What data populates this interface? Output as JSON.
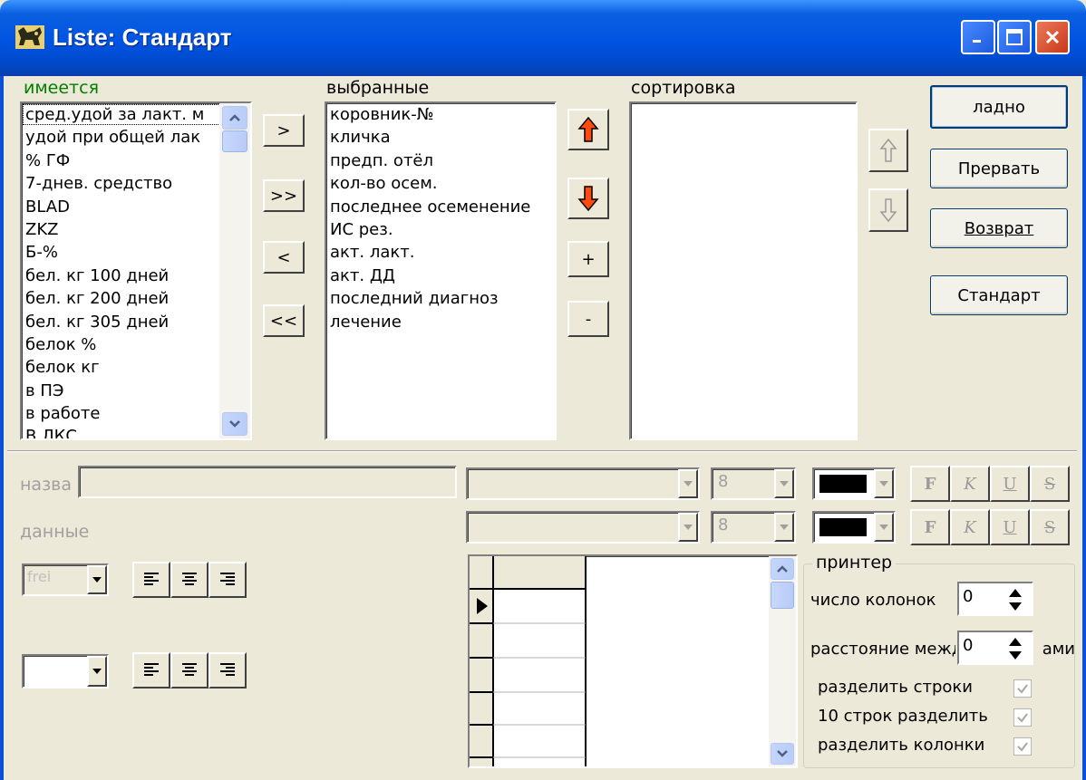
{
  "window": {
    "title": "Liste: Стандарт",
    "accent": "#0054e3",
    "controls": [
      "minimize",
      "maximize",
      "close"
    ]
  },
  "available": {
    "label": "имеется",
    "items": [
      "сред.удой за лакт. м",
      " удой при общей лак",
      "% ГФ",
      "7-днев. средство",
      "BLAD",
      "ZKZ",
      "Б-%",
      "бел. кг 100 дней",
      "бел. кг 200 дней",
      "бел. кг 305 дней",
      "белок %",
      "белок кг",
      "в ПЭ",
      "в работе",
      "В ЛКС"
    ]
  },
  "transfer_buttons": [
    ">",
    ">>",
    "<",
    "<<"
  ],
  "selected": {
    "label": "выбранные",
    "items": [
      "коровник-№",
      "кличка",
      "предп. отёл",
      "кол-во осем.",
      "последнее осеменение",
      "ИС рез.",
      "акт. лакт.",
      "акт. ДД",
      "последний диагноз",
      "лечение"
    ]
  },
  "order_buttons": {
    "up": "up-arrow",
    "down": "down-arrow",
    "add": "+",
    "remove": "-"
  },
  "sorting": {
    "label": "сортировка",
    "items": []
  },
  "action_buttons": {
    "ok": "ладно",
    "cancel": "Прервать",
    "return": "Возврат",
    "standard": "Стандарт"
  },
  "format": {
    "name_label": "назва",
    "data_label": "данные",
    "name_font_size": "8",
    "data_font_size": "8",
    "name_color": "#000000",
    "data_color": "#000000",
    "style_buttons": [
      "F",
      "K",
      "U",
      "S"
    ],
    "align_combo_value": "frei"
  },
  "printer": {
    "legend": "принтер",
    "columns_label": "число колонок",
    "columns_value": "0",
    "spacing_label": "расстояние между колонками",
    "spacing_value": "0",
    "options": [
      {
        "label": "разделить строки",
        "checked": true
      },
      {
        "label": "10 строк разделить",
        "checked": true
      },
      {
        "label": "разделить колонки",
        "checked": true
      }
    ]
  }
}
